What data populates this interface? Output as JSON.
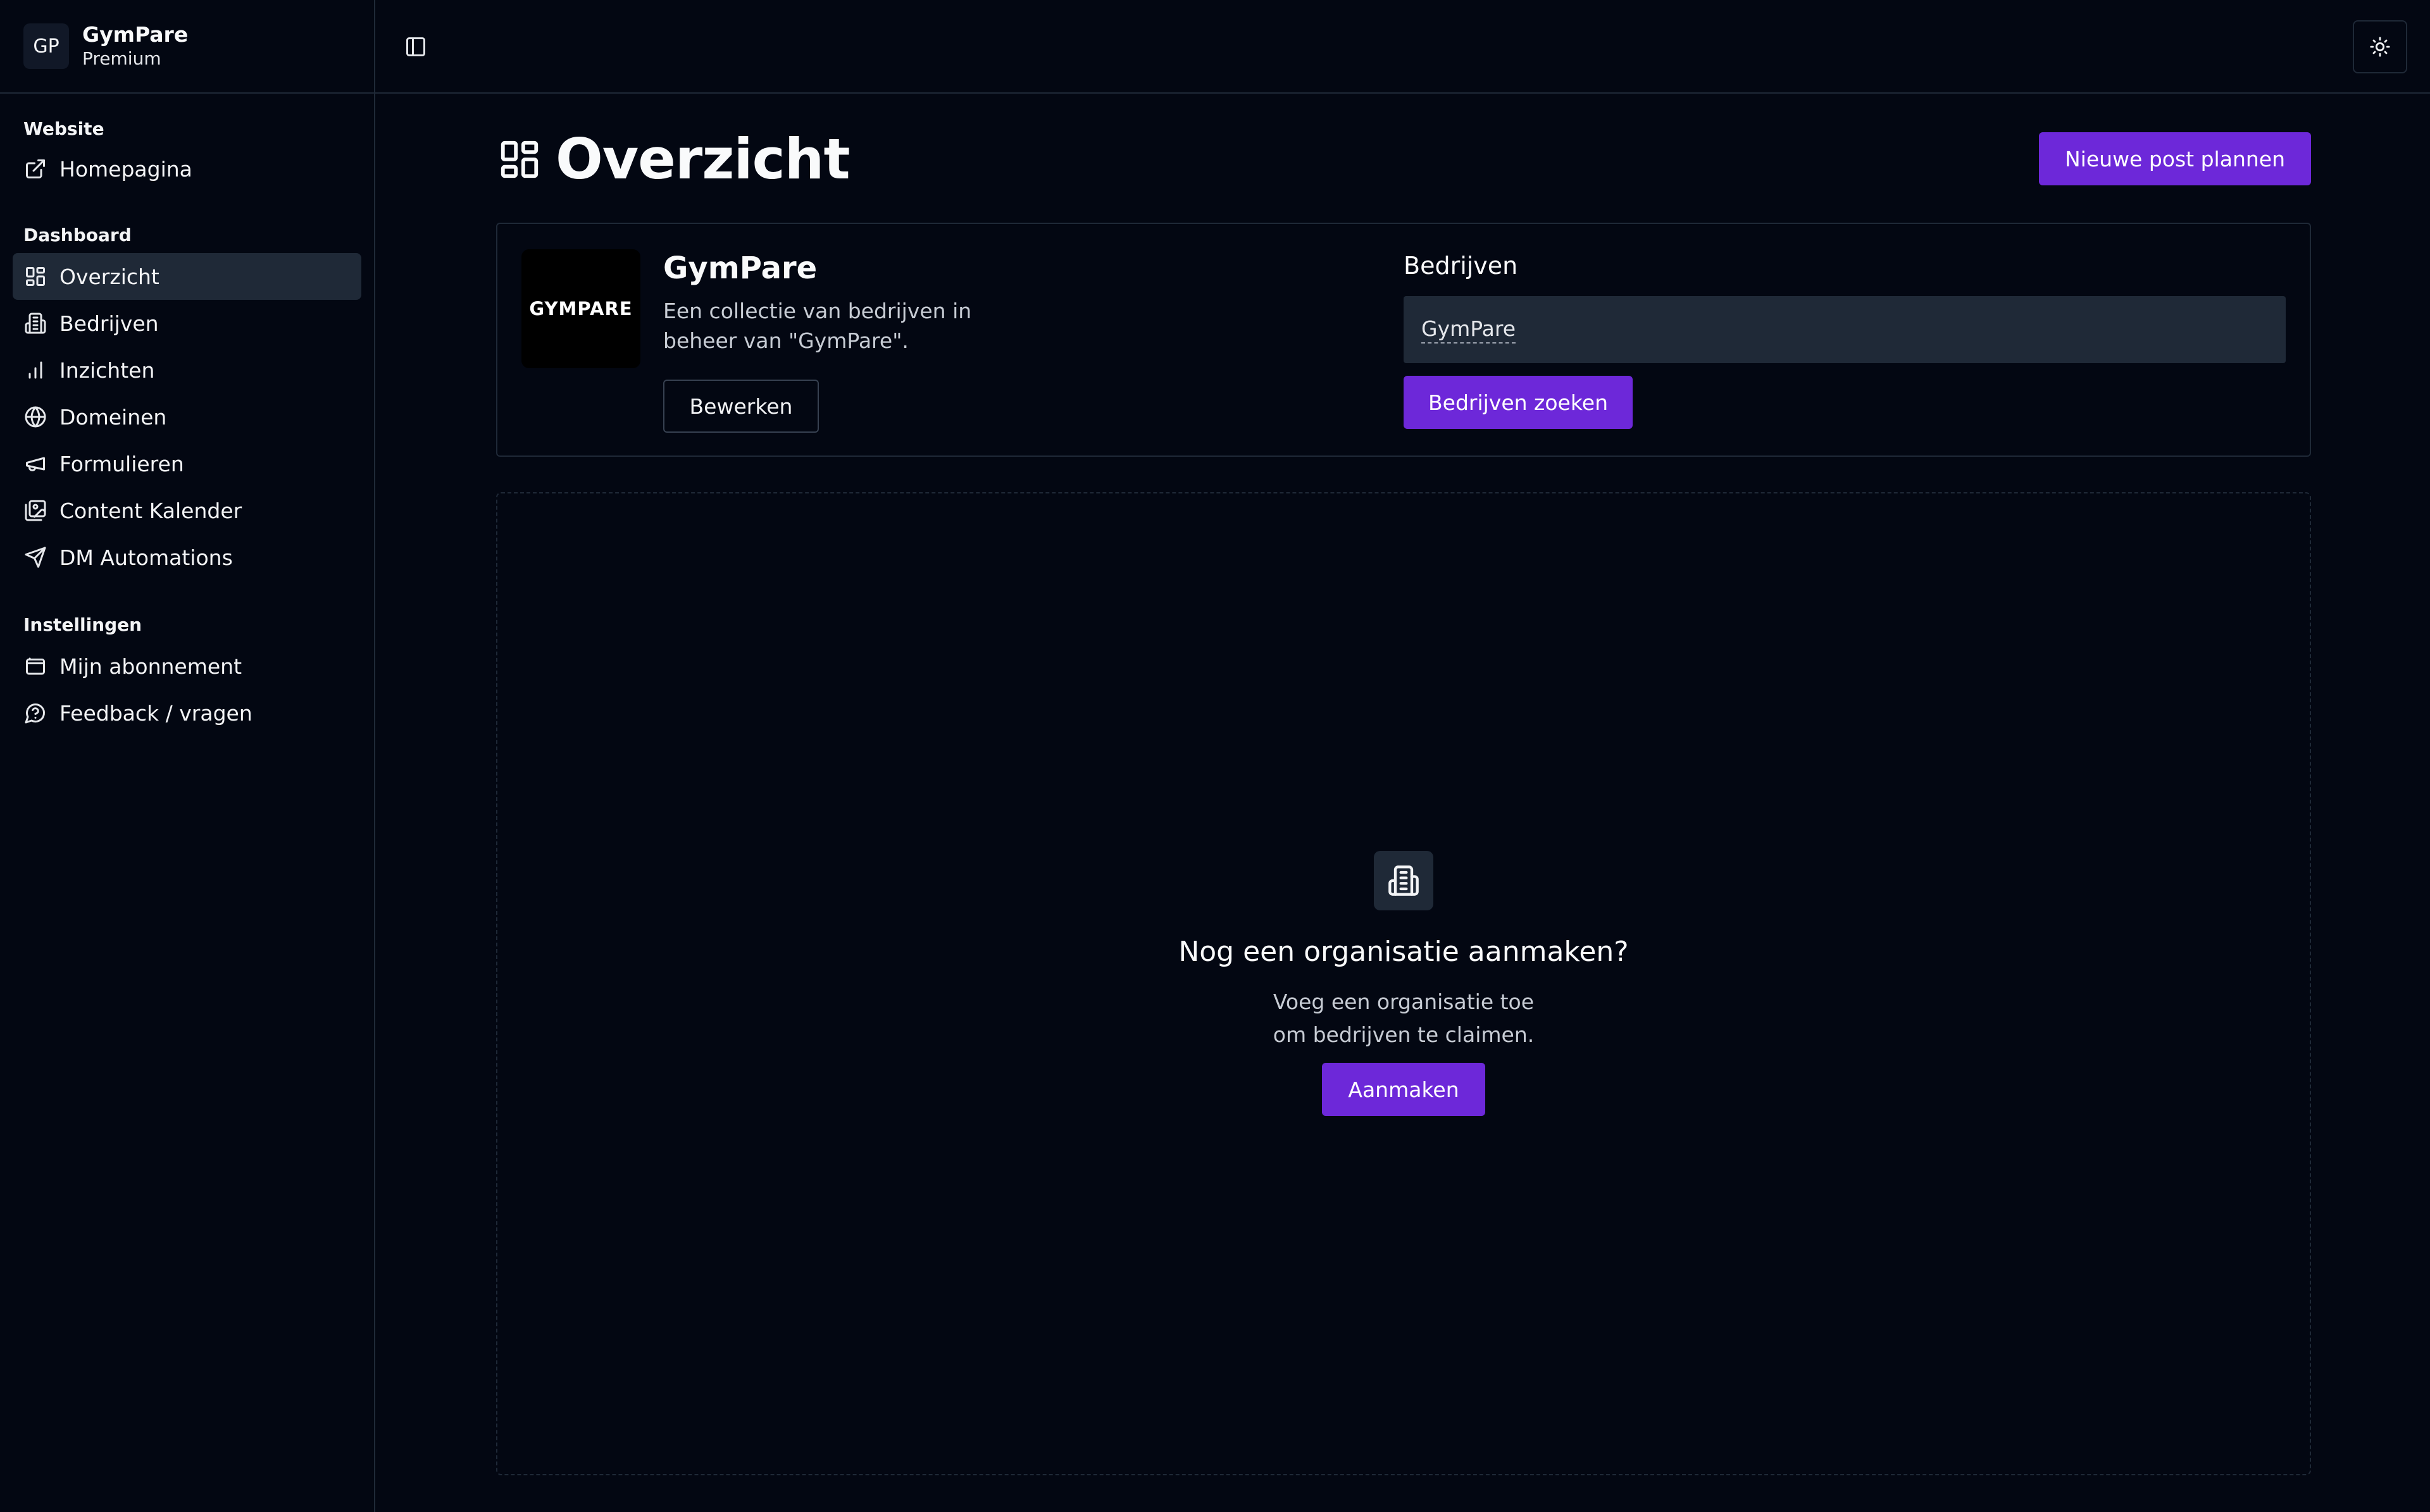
{
  "brand": {
    "initials": "GP",
    "name": "GymPare",
    "plan": "Premium"
  },
  "sidebar": {
    "sections": [
      {
        "label": "Website",
        "items": [
          {
            "label": "Homepagina",
            "icon": "external-link-icon"
          }
        ]
      },
      {
        "label": "Dashboard",
        "items": [
          {
            "label": "Overzicht",
            "icon": "layout-grid-icon",
            "active": true
          },
          {
            "label": "Bedrijven",
            "icon": "building-icon"
          },
          {
            "label": "Inzichten",
            "icon": "bar-chart-icon"
          },
          {
            "label": "Domeinen",
            "icon": "globe-icon"
          },
          {
            "label": "Formulieren",
            "icon": "megaphone-icon"
          },
          {
            "label": "Content Kalender",
            "icon": "images-icon"
          },
          {
            "label": "DM Automations",
            "icon": "send-icon"
          }
        ]
      },
      {
        "label": "Instellingen",
        "items": [
          {
            "label": "Mijn abonnement",
            "icon": "wallet-icon"
          },
          {
            "label": "Feedback / vragen",
            "icon": "help-circle-icon"
          }
        ]
      }
    ]
  },
  "topbar": {
    "toggle_icon": "sidebar-toggle-icon",
    "theme_icon": "sun-icon"
  },
  "main": {
    "title": "Overzicht",
    "title_icon": "layout-grid-icon",
    "new_post_label": "Nieuwe post plannen",
    "org": {
      "logo_text": "GYMPARE",
      "name": "GymPare",
      "description": "Een collectie van bedrijven in beheer van \"GymPare\".",
      "edit_label": "Bewerken",
      "companies_label": "Bedrijven",
      "companies_value": "GymPare",
      "search_label": "Bedrijven zoeken"
    },
    "empty": {
      "icon": "building-icon",
      "title": "Nog een organisatie aanmaken?",
      "text_line1": "Voeg een organisatie toe",
      "text_line2": "om bedrijven te claimen.",
      "button_label": "Aanmaken"
    }
  },
  "colors": {
    "background": "#030712",
    "accent": "#6d28d9",
    "border": "#1f2937",
    "active": "#1f2937"
  }
}
